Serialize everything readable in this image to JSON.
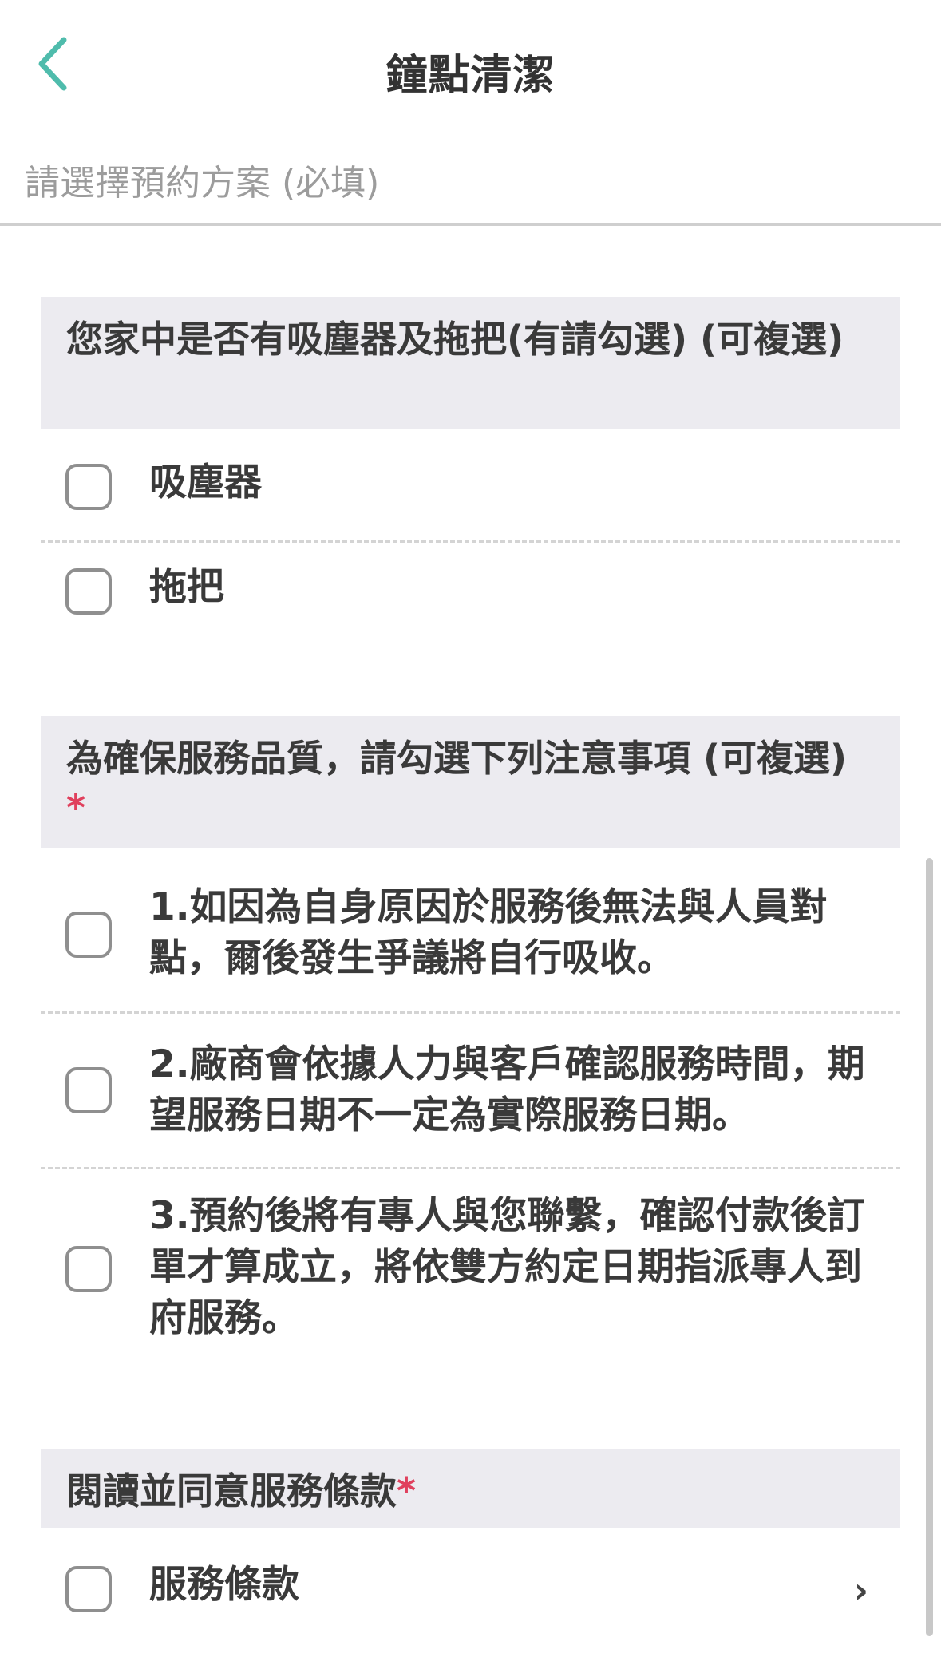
{
  "header": {
    "title": "鐘點清潔",
    "back_icon": "chevron-left-icon",
    "accent_color": "#4fbcac"
  },
  "plan_select": {
    "placeholder": "請選擇預約方案 (必填)"
  },
  "section_equipment": {
    "title": "您家中是否有吸塵器及拖把(有請勾選) (可複選)",
    "options": [
      {
        "label": "吸塵器",
        "checked": false
      },
      {
        "label": "拖把",
        "checked": false
      }
    ]
  },
  "section_notice": {
    "title": "為確保服務品質，請勾選下列注意事項 (可複選)",
    "required_mark": "*",
    "options": [
      {
        "label": "1.如因為自身原因於服務後無法與人員對點，爾後發生爭議將自行吸收。",
        "checked": false
      },
      {
        "label": "2.廠商會依據人力與客戶確認服務時間，期望服務日期不一定為實際服務日期。",
        "checked": false
      },
      {
        "label": "3.預約後將有專人與您聯繫，確認付款後訂單才算成立，將依雙方約定日期指派專人到府服務。",
        "checked": false
      }
    ]
  },
  "section_terms": {
    "title": "閱讀並同意服務條款",
    "required_mark": "*",
    "option": {
      "label": "服務條款",
      "checked": false,
      "chevron": "›"
    }
  },
  "colors": {
    "required": "#e0405d",
    "section_bg": "#ecebf0"
  }
}
